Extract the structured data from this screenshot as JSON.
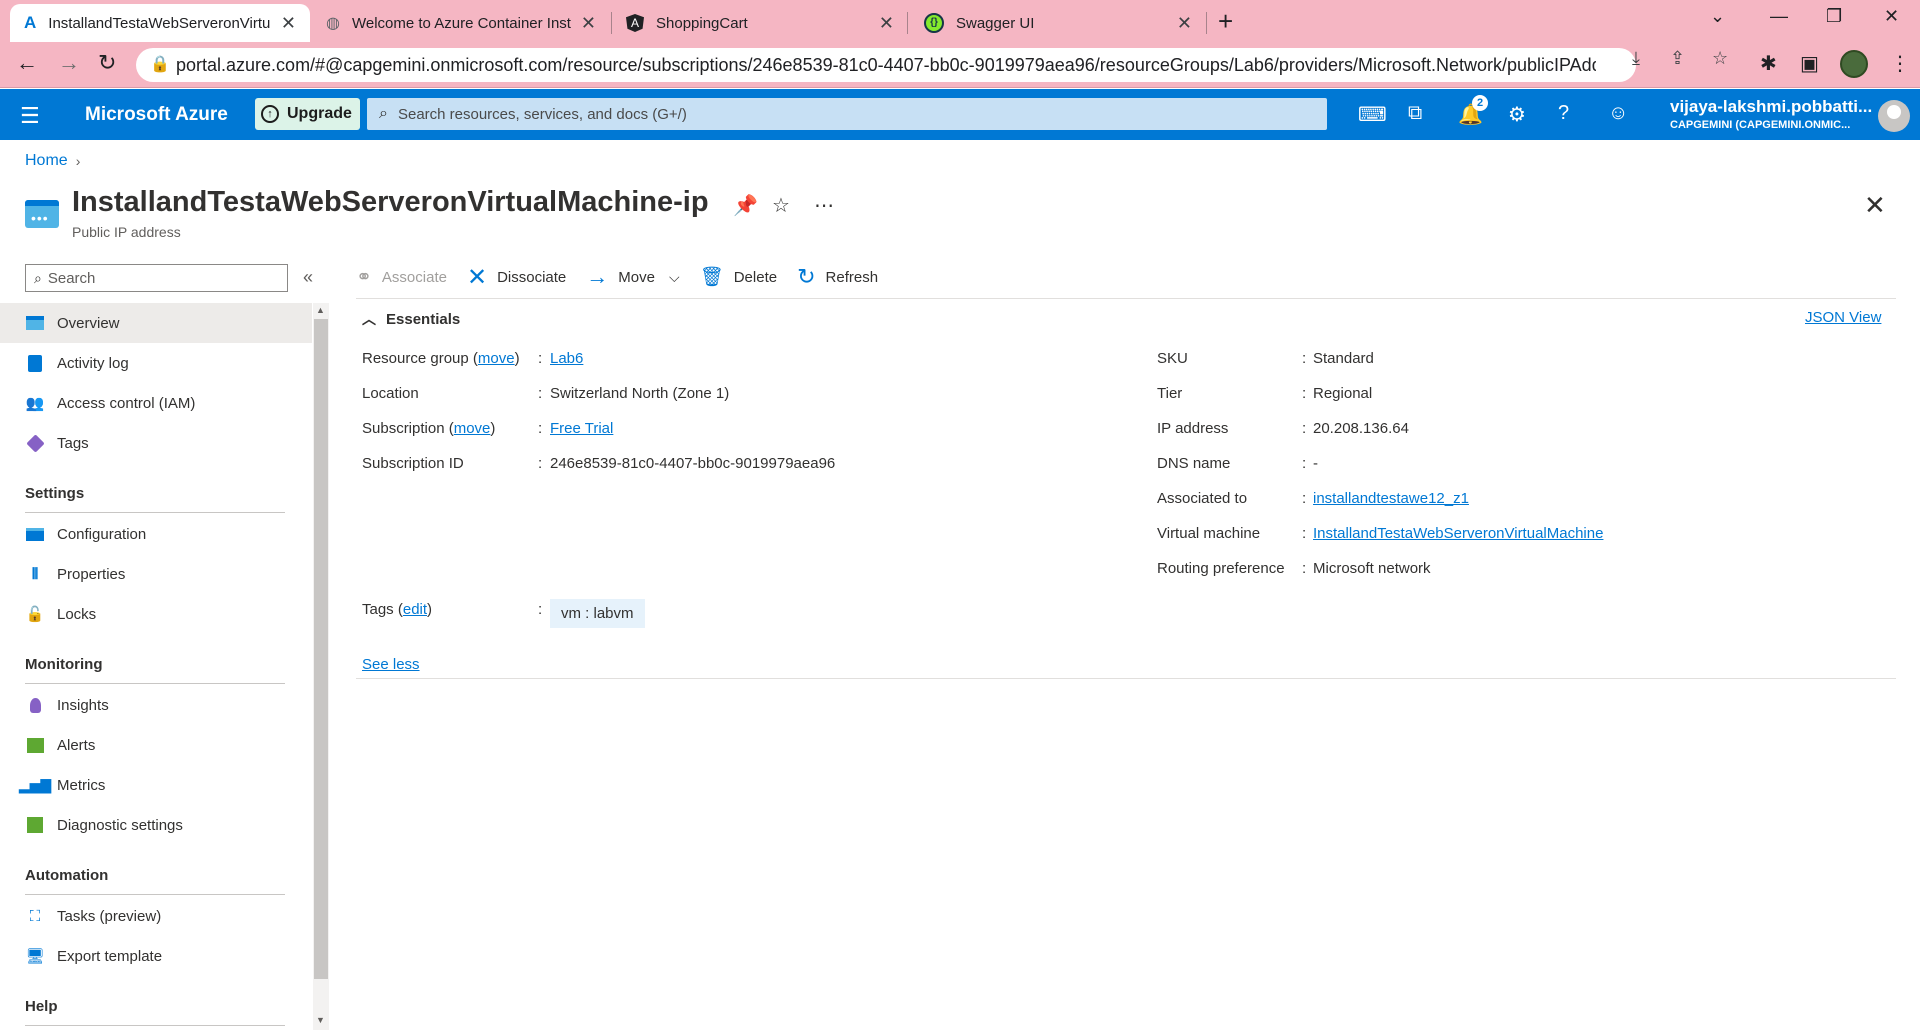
{
  "browser": {
    "tabs": [
      {
        "title": "InstallandTestaWebServeronVirtu",
        "icon": "azure-icon",
        "active": true
      },
      {
        "title": "Welcome to Azure Container Inst",
        "icon": "globe-icon",
        "active": false
      },
      {
        "title": "ShoppingCart",
        "icon": "angular-icon",
        "active": false
      },
      {
        "title": "Swagger UI",
        "icon": "swagger-icon",
        "active": false
      }
    ],
    "url": "portal.azure.com/#@capgemini.onmicrosoft.com/resource/subscriptions/246e8539-81c0-4407-bb0c-9019979aea96/resourceGroups/Lab6/providers/Microsoft.Network/publicIPAddress...",
    "tabbar_color": "#f5b6c3"
  },
  "topbar": {
    "brand": "Microsoft Azure",
    "upgrade_label": "Upgrade",
    "search_placeholder": "Search resources, services, and docs (G+/)",
    "notification_count": "2",
    "user_name": "vijaya-lakshmi.pobbatti...",
    "user_org": "CAPGEMINI (CAPGEMINI.ONMIC...",
    "accent_color": "#0078d4"
  },
  "breadcrumb": {
    "home": "Home"
  },
  "header": {
    "title": "InstallandTestaWebServeronVirtualMachine-ip",
    "subtitle": "Public IP address"
  },
  "sidebar": {
    "search_placeholder": "Search",
    "items": {
      "overview": "Overview",
      "activity_log": "Activity log",
      "access_control": "Access control (IAM)",
      "tags": "Tags",
      "settings_heading": "Settings",
      "configuration": "Configuration",
      "properties": "Properties",
      "locks": "Locks",
      "monitoring_heading": "Monitoring",
      "insights": "Insights",
      "alerts": "Alerts",
      "metrics": "Metrics",
      "diagnostic_settings": "Diagnostic settings",
      "automation_heading": "Automation",
      "tasks": "Tasks (preview)",
      "export_template": "Export template",
      "help_heading": "Help"
    }
  },
  "commands": {
    "associate": "Associate",
    "dissociate": "Dissociate",
    "move": "Move",
    "delete": "Delete",
    "refresh": "Refresh"
  },
  "essentials": {
    "heading": "Essentials",
    "json_view": "JSON View",
    "move_link": "move",
    "edit_link": "edit",
    "left": {
      "resource_group_label": "Resource group",
      "resource_group_value": "Lab6",
      "location_label": "Location",
      "location_value": "Switzerland North (Zone 1)",
      "subscription_label": "Subscription",
      "subscription_value": "Free Trial",
      "subscription_id_label": "Subscription ID",
      "subscription_id_value": "246e8539-81c0-4407-bb0c-9019979aea96"
    },
    "right": {
      "sku_label": "SKU",
      "sku_value": "Standard",
      "tier_label": "Tier",
      "tier_value": "Regional",
      "ip_label": "IP address",
      "ip_value": "20.208.136.64",
      "dns_label": "DNS name",
      "dns_value": "-",
      "associated_label": "Associated to",
      "associated_value": "installandtestawe12_z1",
      "vm_label": "Virtual machine",
      "vm_value": "InstallandTestaWebServeronVirtualMachine",
      "routing_label": "Routing preference",
      "routing_value": "Microsoft network"
    },
    "tags_label": "Tags",
    "tag_chip": "vm : labvm",
    "see_less": "See less"
  }
}
